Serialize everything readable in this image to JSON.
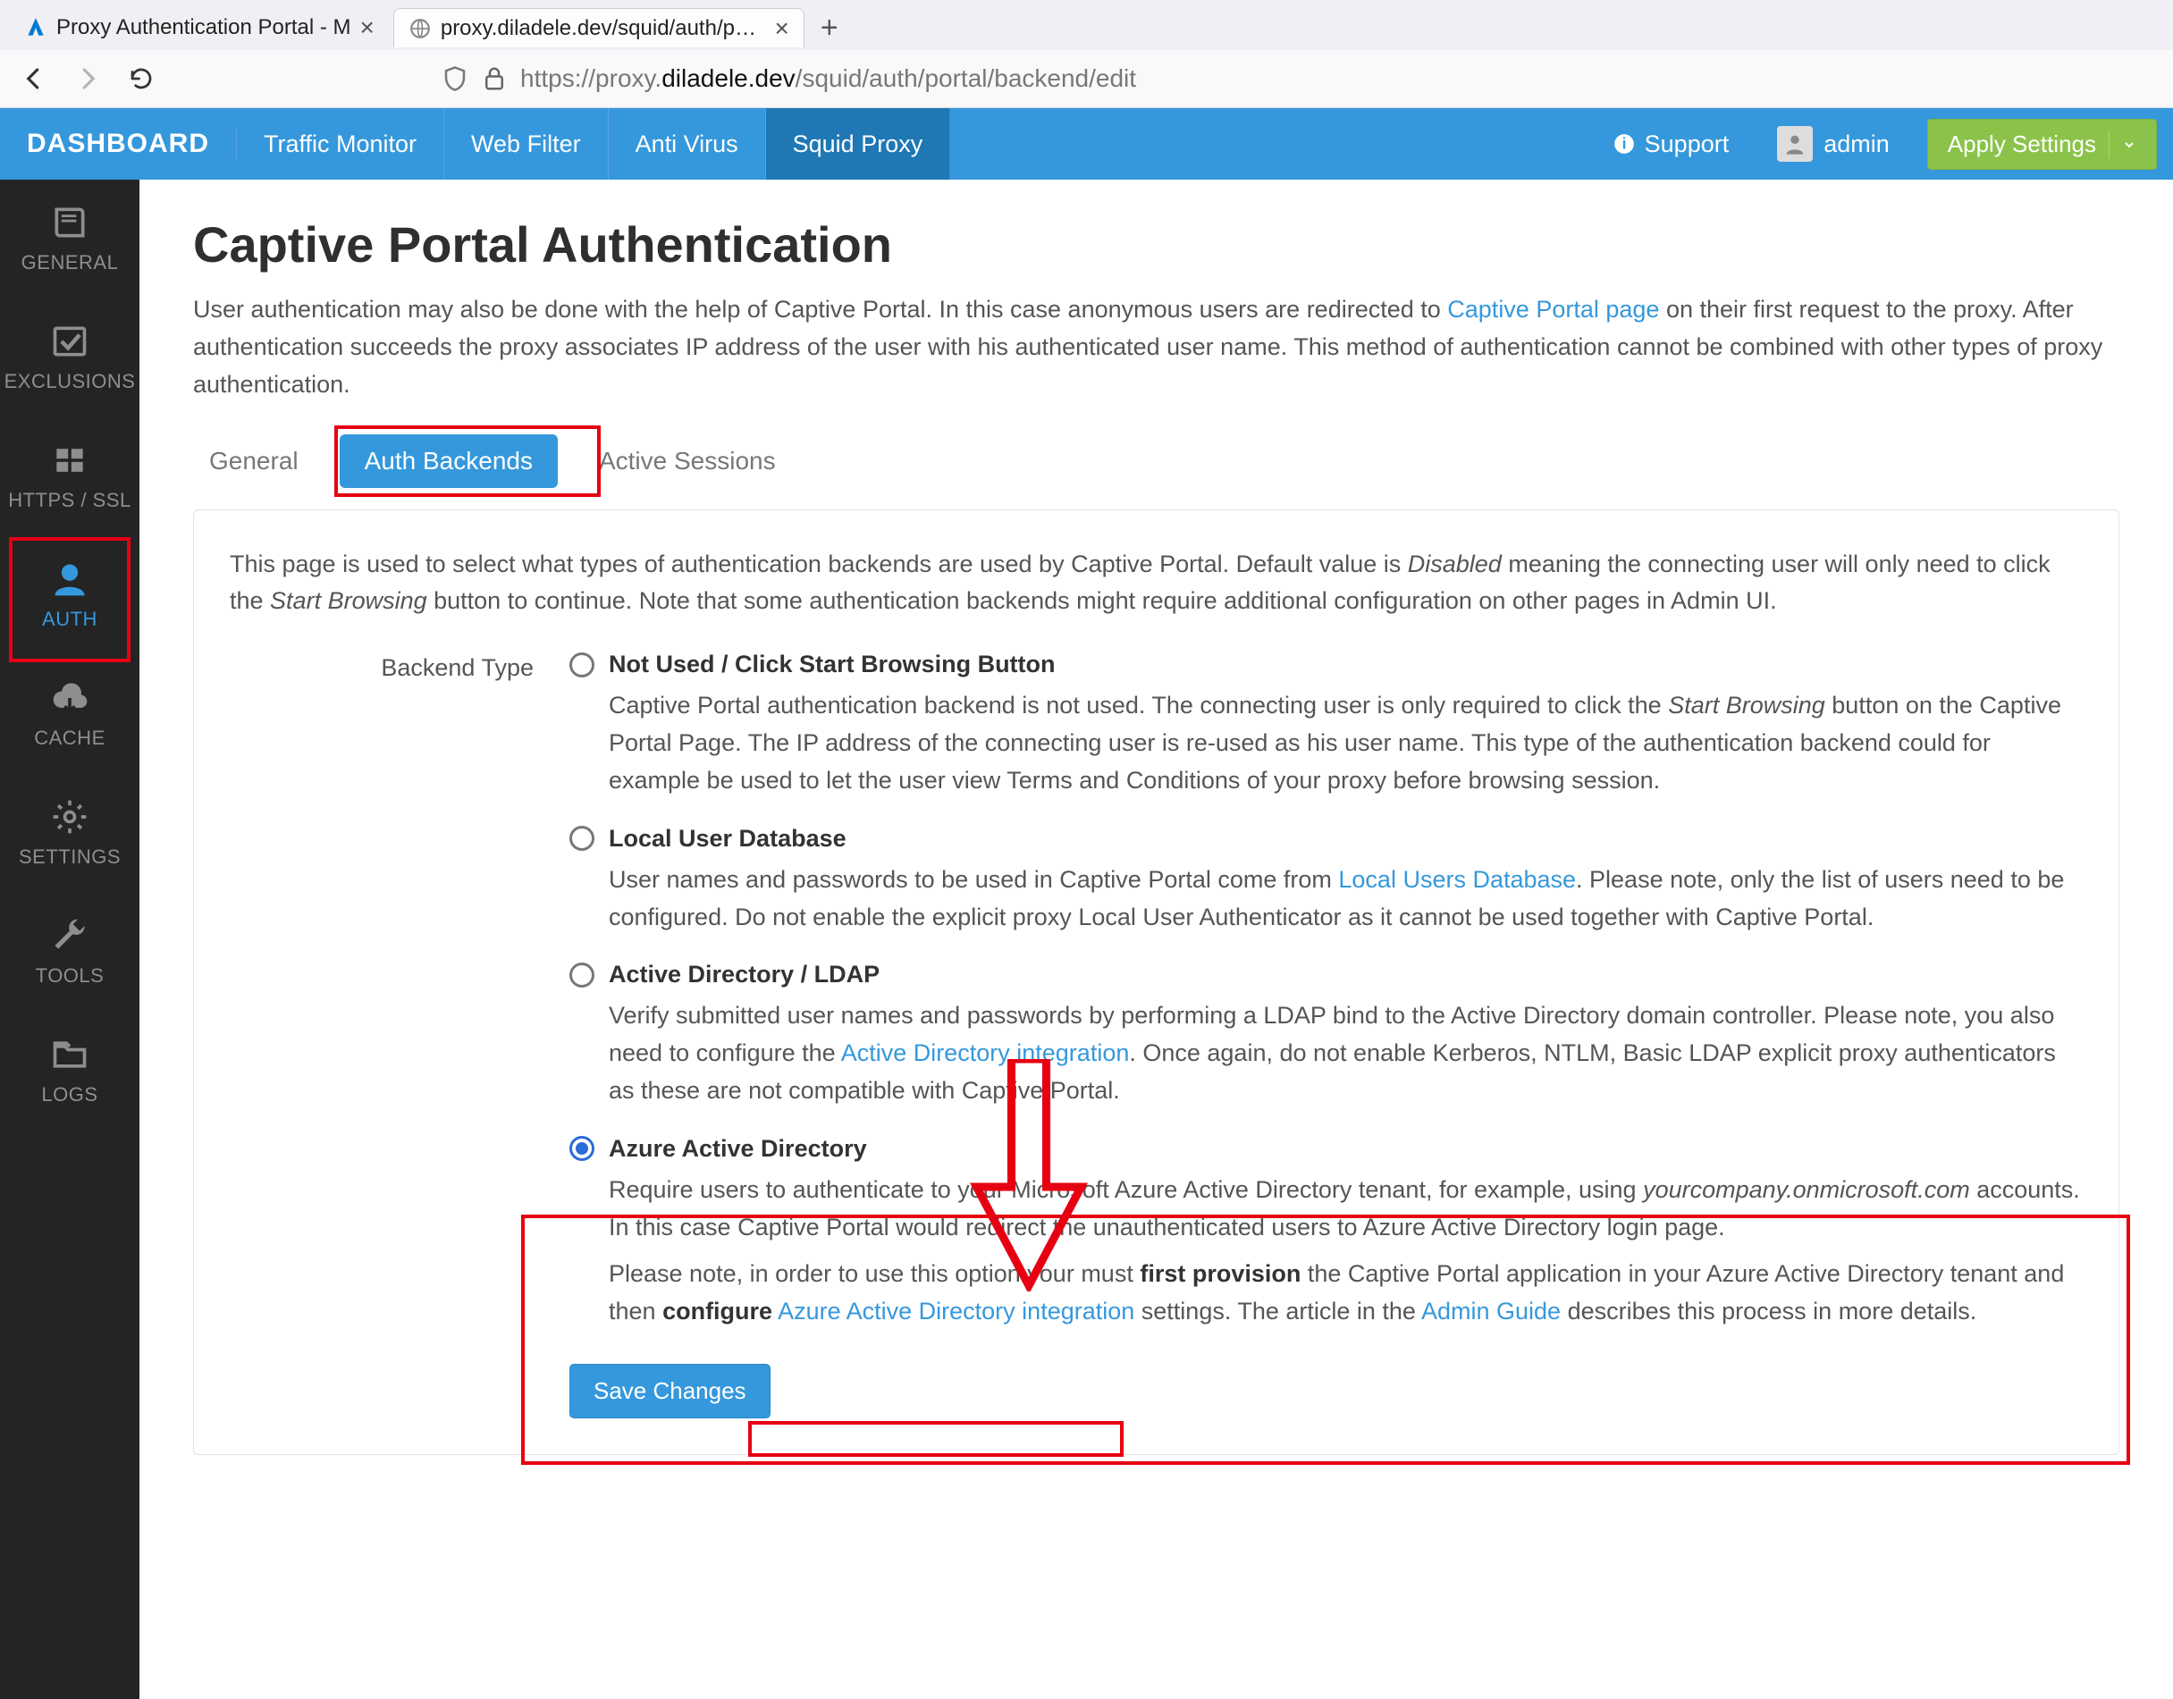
{
  "browser": {
    "tabs": [
      {
        "title": "Proxy Authentication Portal - M",
        "active": false
      },
      {
        "title": "proxy.diladele.dev/squid/auth/porta",
        "active": true
      }
    ],
    "url_prefix": "https://proxy.",
    "url_host": "diladele.dev",
    "url_path": "/squid/auth/portal/backend/edit"
  },
  "topbar": {
    "brand": "DASHBOARD",
    "nav": [
      "Traffic Monitor",
      "Web Filter",
      "Anti Virus",
      "Squid Proxy"
    ],
    "support": "Support",
    "user": "admin",
    "apply": "Apply Settings"
  },
  "sidebar": {
    "items": [
      {
        "label": "GENERAL",
        "icon": "book"
      },
      {
        "label": "EXCLUSIONS",
        "icon": "check-box"
      },
      {
        "label": "HTTPS / SSL",
        "icon": "grid"
      },
      {
        "label": "AUTH",
        "icon": "user",
        "active": true
      },
      {
        "label": "CACHE",
        "icon": "cloud-down"
      },
      {
        "label": "SETTINGS",
        "icon": "gear"
      },
      {
        "label": "TOOLS",
        "icon": "wrench"
      },
      {
        "label": "LOGS",
        "icon": "folder-open"
      }
    ]
  },
  "page": {
    "title": "Captive Portal Authentication",
    "intro_a": "User authentication may also be done with the help of Captive Portal. In this case anonymous users are redirected to ",
    "intro_link": "Captive Portal page",
    "intro_b": " on their first request to the proxy. After authentication succeeds the proxy associates IP address of the user with his authenticated user name. This method of authentication cannot be combined with other types of proxy authentication.",
    "tabs": [
      "General",
      "Auth Backends",
      "Active Sessions"
    ],
    "card_intro_a": "This page is used to select what types of authentication backends are used by Captive Portal. Default value is ",
    "card_intro_em": "Disabled",
    "card_intro_b": " meaning the connecting user will only need to click the ",
    "card_intro_em2": "Start Browsing",
    "card_intro_c": " button to continue. Note that some authentication backends might require additional configuration on other pages in Admin UI.",
    "form_label": "Backend Type",
    "options": {
      "notused": {
        "title": "Not Used / Click Start Browsing Button",
        "desc_a": "Captive Portal authentication backend is not used. The connecting user is only required to click the ",
        "desc_em": "Start Browsing",
        "desc_b": " button on the Captive Portal Page. The IP address of the connecting user is re-used as his user name. This type of the authentication backend could for example be used to let the user view Terms and Conditions of your proxy before browsing session."
      },
      "local": {
        "title": "Local User Database",
        "desc_a": "User names and passwords to be used in Captive Portal come from ",
        "link": "Local Users Database",
        "desc_b": ". Please note, only the list of users need to be configured. Do not enable the explicit proxy Local User Authenticator as it cannot be used together with Captive Portal."
      },
      "ad": {
        "title": "Active Directory / LDAP",
        "desc_a": "Verify submitted user names and passwords by performing a LDAP bind to the Active Directory domain controller. Please note, you also need to configure the ",
        "link": "Active Directory integration",
        "desc_b": ". Once again, do not enable Kerberos, NTLM, Basic LDAP explicit proxy authenticators as these are not compatible with Captive Portal."
      },
      "aad": {
        "title": "Azure Active Directory",
        "desc_a": "Require users to authenticate to your Microsoft Azure Active Directory tenant, for example, using ",
        "desc_em": "yourcompany.onmicrosoft.com",
        "desc_b": " accounts. In this case Captive Portal would redirect the unauthenticated users to Azure Active Directory login page.",
        "desc2_a": "Please note, in order to use this option your must ",
        "desc2_strong1": "first provision",
        "desc2_b": " the Captive Portal application in your Azure Active Directory tenant and then ",
        "desc2_strong2": "configure",
        "desc2_c": " ",
        "link": "Azure Active Directory integration",
        "desc2_d": " settings. The article in the ",
        "link2": "Admin Guide",
        "desc2_e": " describes this process in more details."
      }
    },
    "save": "Save Changes"
  }
}
